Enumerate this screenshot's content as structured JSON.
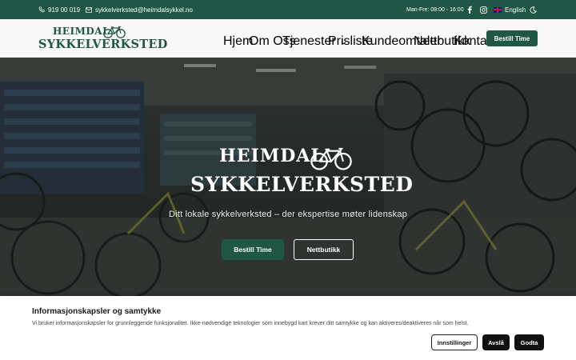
{
  "topbar": {
    "phone": "919 00 019",
    "email": "sykkelverksted@heimdalsykkel.no",
    "hours": "Man-Fre: 08:00 - 16:00",
    "language": "English",
    "icons": [
      "phone-icon",
      "mail-icon",
      "facebook-icon",
      "instagram-icon",
      "uk-flag-icon",
      "moon-icon"
    ]
  },
  "logo": {
    "line1": "HEIMDAL",
    "line2": "SYKKELVERKSTED"
  },
  "nav": {
    "items": [
      "Hjem",
      "Om Oss",
      "Tjenester",
      "Prisliste",
      "Kundeomtaler",
      "Nettbutikk",
      "Kontakt"
    ],
    "cta": "Bestill Time"
  },
  "hero": {
    "line1": "HEIMDAL",
    "line2": "SYKKELVERKSTED",
    "tagline": "Ditt lokale sykkelverksted – der ekspertise møter lidenskap",
    "primary_button": "Bestill Time",
    "secondary_button": "Nettbutikk"
  },
  "cookie": {
    "title": "Informasjonskapsler og samtykke",
    "text": "Vi bruker informasjonskapsler for grunnleggende funksjonalitet. Ikke-nødvendige teknologier som innebygd kart krever ditt samtykke og kan aktiveres/deaktiveres når som helst.",
    "settings_button": "Innstillinger",
    "deny_button": "Avslå",
    "accept_button": "Godta"
  },
  "colors": {
    "brand": "#1f5646",
    "dark": "#111111"
  }
}
